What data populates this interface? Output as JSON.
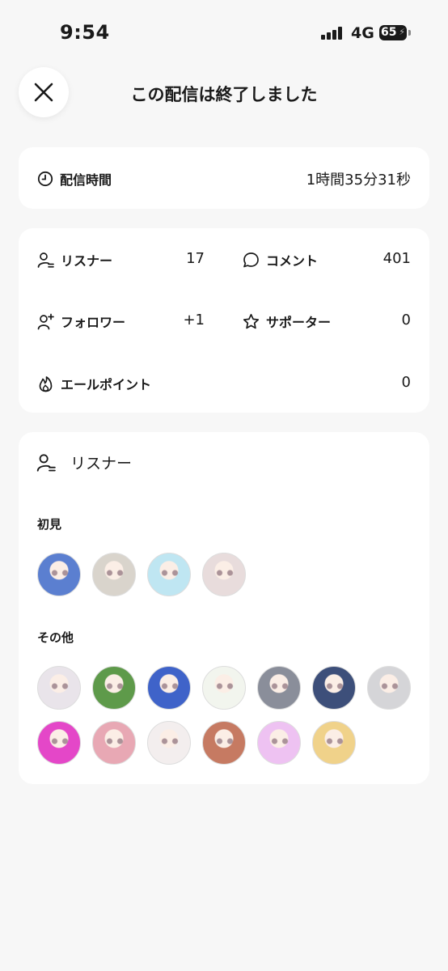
{
  "status_bar": {
    "time": "9:54",
    "network": "4G",
    "battery": "65"
  },
  "header": {
    "title": "この配信は終了しました",
    "close_icon": "close-icon"
  },
  "duration": {
    "label": "配信時間",
    "value": "1時間35分31秒",
    "icon": "clock-icon"
  },
  "stats": {
    "listeners": {
      "label": "リスナー",
      "value": "17",
      "icon": "person-list-icon"
    },
    "comments": {
      "label": "コメント",
      "value": "401",
      "icon": "speech-bubble-icon"
    },
    "followers": {
      "label": "フォロワー",
      "value": "+1",
      "icon": "person-add-icon"
    },
    "supporters": {
      "label": "サポーター",
      "value": "0",
      "icon": "star-icon"
    },
    "yell_points": {
      "label": "エールポイント",
      "value": "0",
      "icon": "flame-icon"
    }
  },
  "listeners_section": {
    "title": "リスナー",
    "icon": "person-list-icon",
    "first_time_heading": "初見",
    "others_heading": "その他",
    "first_time_avatars": [
      {
        "color": "#5b7fd0"
      },
      {
        "color": "#d9d4cc"
      },
      {
        "color": "#bfe6f2"
      },
      {
        "color": "#e8dcdc"
      }
    ],
    "other_avatars": [
      {
        "color": "#e9e4ea"
      },
      {
        "color": "#5e9a4a"
      },
      {
        "color": "#3f63c9"
      },
      {
        "color": "#f2f5ee"
      },
      {
        "color": "#8a8e9a"
      },
      {
        "color": "#3d4f7a"
      },
      {
        "color": "#d5d5d8"
      },
      {
        "color": "#e447c8"
      },
      {
        "color": "#e8a8b4"
      },
      {
        "color": "#f3eeee"
      },
      {
        "color": "#c67a62"
      },
      {
        "color": "#eec2f2"
      },
      {
        "color": "#f0d28a"
      }
    ]
  },
  "colors": {
    "background": "#f7f7f7",
    "card": "#ffffff",
    "text": "#1a1a1a"
  }
}
